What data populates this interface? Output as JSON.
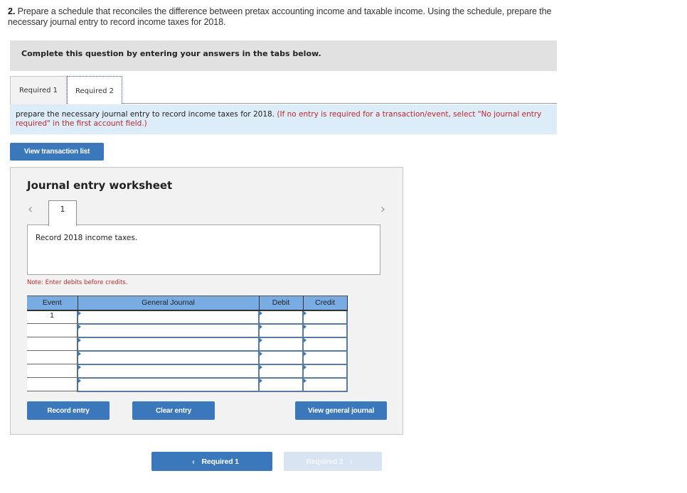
{
  "question": {
    "number": "2.",
    "text": " Prepare a schedule that reconciles the difference between pretax accounting income and taxable income. Using the schedule, prepare the necessary journal entry to record income taxes for 2018."
  },
  "banner": "Complete this question by entering your answers in the tabs below.",
  "tabs": [
    {
      "label": "Required 1",
      "active": false
    },
    {
      "label": "Required 2",
      "active": true
    }
  ],
  "instruction": {
    "text": "prepare the necessary journal entry to record income taxes for 2018. ",
    "note": "(If no entry is required for a transaction/event, select \"No journal entry required\" in the first account field.)"
  },
  "buttons": {
    "view_transaction_list": "View transaction list",
    "record_entry": "Record entry",
    "clear_entry": "Clear entry",
    "view_general_journal": "View general journal"
  },
  "worksheet": {
    "title": "Journal entry worksheet",
    "prev_icon": "‹",
    "next_icon": "›",
    "current_entry": "1",
    "description": "Record 2018 income taxes.",
    "note": "Note: Enter debits before credits.",
    "table": {
      "headers": [
        "Event",
        "General Journal",
        "Debit",
        "Credit"
      ],
      "rows": [
        {
          "event": "1",
          "account": "",
          "debit": "",
          "credit": ""
        },
        {
          "event": "",
          "account": "",
          "debit": "",
          "credit": ""
        },
        {
          "event": "",
          "account": "",
          "debit": "",
          "credit": ""
        },
        {
          "event": "",
          "account": "",
          "debit": "",
          "credit": ""
        },
        {
          "event": "",
          "account": "",
          "debit": "",
          "credit": ""
        },
        {
          "event": "",
          "account": "",
          "debit": "",
          "credit": ""
        }
      ]
    }
  },
  "footer_nav": {
    "prev_label": "Required 1",
    "next_label": "Required 2",
    "prev_icon": "‹",
    "next_icon": "›",
    "next_disabled": true
  },
  "colors": {
    "accent": "#3a78bb",
    "header_blue": "#78ace3",
    "note_red": "#c0272d",
    "instruction_bg": "#dcecf8"
  }
}
